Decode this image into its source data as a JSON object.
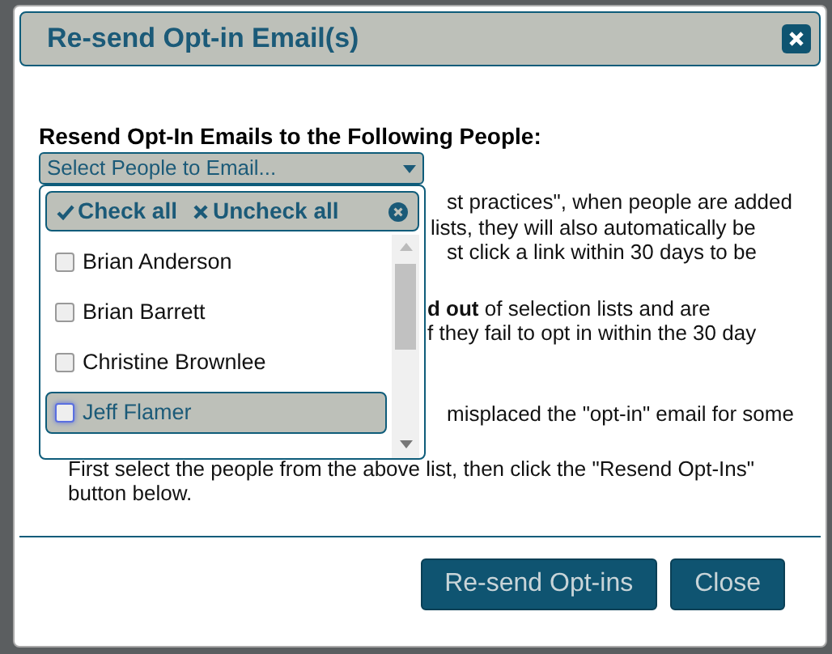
{
  "dialog": {
    "title": "Re-send Opt-in Email(s)"
  },
  "field_label": "Resend Opt-In Emails to the Following People:",
  "select": {
    "placeholder": "Select People to Email..."
  },
  "dropdown": {
    "check_all": "Check all",
    "uncheck_all": "Uncheck all",
    "items": [
      {
        "label": "Brian Anderson",
        "checked": false,
        "highlighted": false
      },
      {
        "label": "Brian Barrett",
        "checked": false,
        "highlighted": false
      },
      {
        "label": "Christine Brownlee",
        "checked": false,
        "highlighted": false
      },
      {
        "label": "Jeff Flamer",
        "checked": false,
        "highlighted": true
      }
    ]
  },
  "paragraphs": [
    [
      "st practices\", when people are added",
      "lists, they will also automatically be",
      "st click a link within 30 days to be"
    ],
    [
      "**d out** of selection lists and are",
      "f they fail to opt in within the 30 day"
    ],
    [
      "misplaced the \"opt-in\" email for some"
    ]
  ],
  "instructions": "First select the people from the above list, then click the \"Resend Opt-Ins\" button below.",
  "buttons": [
    "Re-send Opt-ins",
    "Close"
  ]
}
